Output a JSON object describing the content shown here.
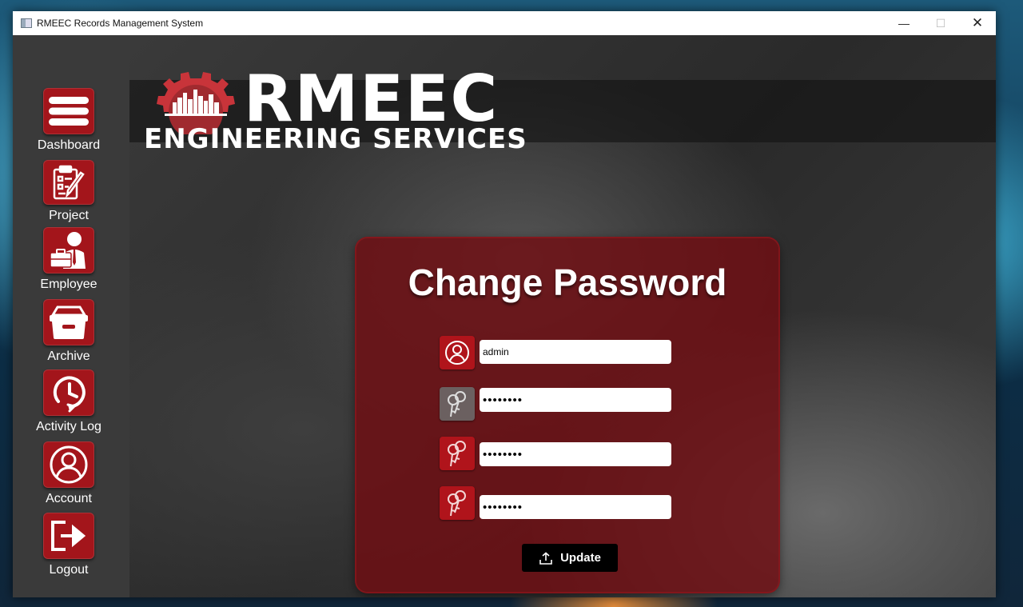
{
  "window": {
    "title": "RMEEC Records Management System",
    "minimize_glyph": "—",
    "maximize_glyph": "☐",
    "close_glyph": "✕"
  },
  "sidebar": {
    "items": [
      {
        "label": "Dashboard",
        "icon": "menu-icon"
      },
      {
        "label": "Project",
        "icon": "clipboard-edit-icon"
      },
      {
        "label": "Employee",
        "icon": "employee-briefcase-icon"
      },
      {
        "label": "Archive",
        "icon": "archive-box-icon"
      },
      {
        "label": "Activity Log",
        "icon": "history-clock-icon"
      },
      {
        "label": "Account",
        "icon": "user-circle-icon"
      },
      {
        "label": "Logout",
        "icon": "logout-icon"
      }
    ]
  },
  "logo": {
    "line1": "RMEEC",
    "line2": "ENGINEERING SERVICES"
  },
  "form": {
    "title": "Change Password",
    "username_value": "admin",
    "old_password_mask": "••••••••",
    "new_password_mask": "••••••••",
    "confirm_password_mask": "••••••••",
    "update_label": "Update"
  },
  "colors": {
    "accent": "#a3151b",
    "panel": "#700e12",
    "sidebar": "#3a3a3a"
  }
}
